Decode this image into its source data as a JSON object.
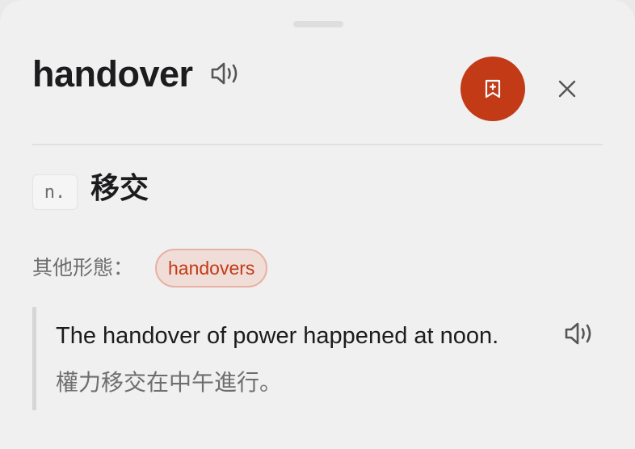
{
  "entry": {
    "word": "handover",
    "part_of_speech": "n.",
    "meaning": "移交",
    "other_forms_label": "其他形態：",
    "other_forms": [
      "handovers"
    ]
  },
  "example": {
    "english": "The handover of power happened at noon.",
    "chinese": "權力移交在中午進行。"
  },
  "icons": {
    "pronounce": "speaker-icon",
    "bookmark": "bookmark-add-icon",
    "close": "close-icon"
  },
  "colors": {
    "accent": "#c23a16",
    "chip_background": "#f1ddd8",
    "chip_border": "#e8b1a4",
    "text_primary": "#1c1c1e",
    "text_secondary": "#6e6e6e"
  }
}
